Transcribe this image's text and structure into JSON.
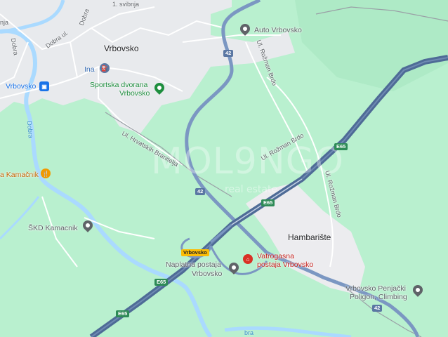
{
  "town": {
    "name": "Vrbovsko"
  },
  "hamlet": {
    "name": "Hambarište"
  },
  "street_labels": {
    "dobra_ul": "Dobra ul.",
    "dobra1": "Dobra",
    "dobra_top": "Dobra",
    "svibnja": "1. svibnja",
    "rozman1": "Ul. Rožman Brdo",
    "rozman2": "Ul. Rožman Brdo",
    "rozman3": "Ul. Rožman Brdo",
    "hrvatskih": "Ul. Hrvatskih Branitelja",
    "top_left": "nja"
  },
  "water_labels": {
    "dobra_river": "Dobra",
    "bottom": "bra"
  },
  "pois": {
    "auto": "Auto Vrbovsko",
    "ina": "Ina",
    "sport1": "Sportska dvorana",
    "sport2": "Vrbovsko",
    "station": "Vrbovsko",
    "kamacnik": "a Kamačnik",
    "skd": "ŠKD Kamacnik",
    "naplatna1": "Naplatna postaja",
    "naplatna2": "Vrbovsko",
    "vatro1": "Vatrogasna",
    "vatro2": "postaja Vrbovsko",
    "climb1": "Vrbovsko Penjački",
    "climb2": "Poligon, Climbing"
  },
  "shields": {
    "r42_top": "42",
    "r42_mid": "42",
    "r42_bottom": "42",
    "e65_a": "E65",
    "e65_b": "E65",
    "e65_c": "E65",
    "e65_d": "E65",
    "exit": "Vrbovsko"
  },
  "watermark": {
    "main": "MOL9NGO",
    "sub": "real estate"
  },
  "colors": {
    "land": "#b9f0cf",
    "urban": "#e8eaed",
    "forest": "#a8e8c0",
    "motorway": "#5a77a3",
    "road": "#7b97c2",
    "river": "#aadaff"
  },
  "icons": {
    "auto": "location-pin-icon",
    "ina": "gas-station-icon",
    "sport": "location-pin-icon",
    "station": "train-station-icon",
    "kamacnik": "restaurant-icon",
    "skd": "location-pin-icon",
    "naplatna": "location-pin-icon",
    "vatro": "fire-station-icon",
    "climb": "location-pin-icon"
  }
}
